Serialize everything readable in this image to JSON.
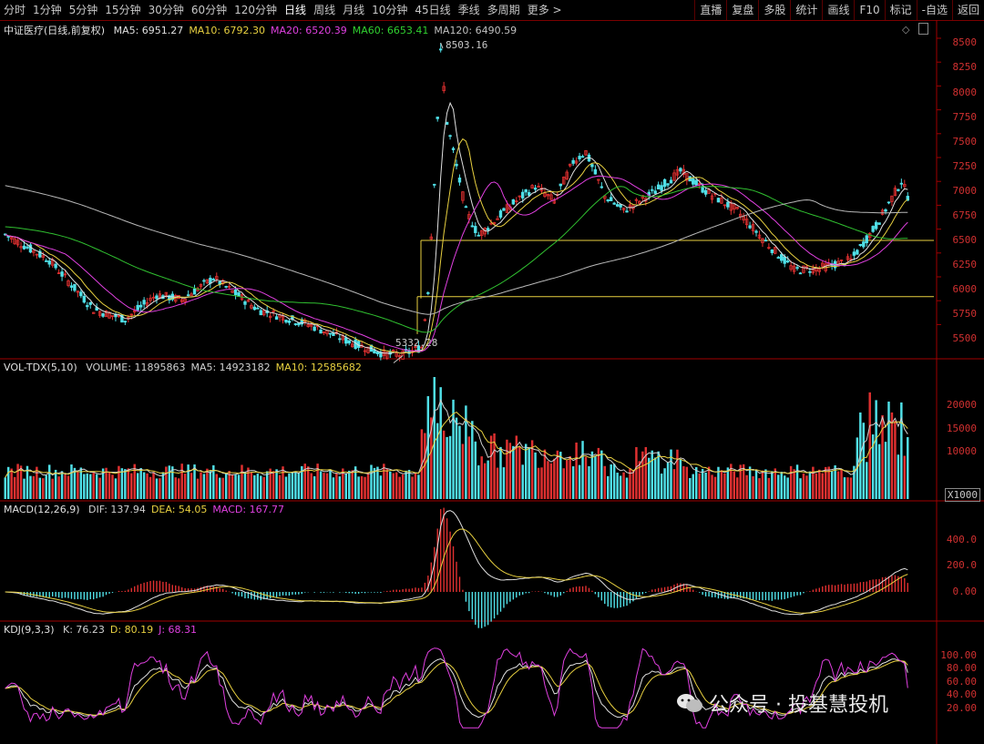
{
  "toolbar": {
    "periods": [
      "分时",
      "1分钟",
      "5分钟",
      "15分钟",
      "30分钟",
      "60分钟",
      "120分钟",
      "日线",
      "周线",
      "月线",
      "10分钟",
      "45日线",
      "季线",
      "多周期",
      "更多 >"
    ],
    "active_period": "日线",
    "right_buttons": [
      "直播",
      "复盘",
      "多股",
      "统计",
      "画线",
      "F10",
      "标记",
      "-自选",
      "返回"
    ]
  },
  "price_panel": {
    "title": "中证医疗(日线,前复权)",
    "ma": [
      {
        "label": "MA5: 6951.27",
        "color": "#e0e0e0"
      },
      {
        "label": "MA10: 6792.30",
        "color": "#e8d040"
      },
      {
        "label": "MA20: 6520.39",
        "color": "#e040e0"
      },
      {
        "label": "MA60: 6653.41",
        "color": "#30d030"
      },
      {
        "label": "MA120: 6490.59",
        "color": "#c0c0c0"
      }
    ],
    "yticks": [
      "8500",
      "8250",
      "8000",
      "7750",
      "7500",
      "7250",
      "7000",
      "6750",
      "6500",
      "6250",
      "6000",
      "5750",
      "5500"
    ],
    "high_label": "8503.16",
    "low_label": "5332.28",
    "ymin": 5300,
    "ymax": 8550
  },
  "volume_panel": {
    "title": "VOL-TDX(5,10)",
    "items": [
      {
        "label": "VOLUME: 11895863",
        "color": "#d0d0d0"
      },
      {
        "label": "MA5: 14923182",
        "color": "#d0d0d0"
      },
      {
        "label": "MA10: 12585682",
        "color": "#e8d040"
      }
    ],
    "yticks": [
      "20000",
      "15000",
      "10000"
    ],
    "unit": "X1000"
  },
  "macd_panel": {
    "title": "MACD(12,26,9)",
    "items": [
      {
        "label": "DIF: 137.94",
        "color": "#d0d0d0"
      },
      {
        "label": "DEA: 54.05",
        "color": "#e8d040"
      },
      {
        "label": "MACD: 167.77",
        "color": "#e040e0"
      }
    ],
    "yticks": [
      "400.0",
      "200.0",
      "0.00"
    ]
  },
  "kdj_panel": {
    "title": "KDJ(9,3,3)",
    "items": [
      {
        "label": "K: 76.23",
        "color": "#d0d0d0"
      },
      {
        "label": "D: 80.19",
        "color": "#e8d040"
      },
      {
        "label": "J: 68.31",
        "color": "#e040e0"
      }
    ],
    "yticks": [
      "100.00",
      "80.00",
      "60.00",
      "40.00",
      "20.00"
    ]
  },
  "watermark": "公众号 · 投基慧投机",
  "colors": {
    "up": "#e03030",
    "down": "#50e0e8",
    "ma5": "#e0e0e0",
    "ma10": "#e8d040",
    "ma20": "#e040e0",
    "ma60": "#30c030",
    "ma120": "#b8b8b8",
    "line": "#e8d040",
    "axis": "#a00000"
  }
}
